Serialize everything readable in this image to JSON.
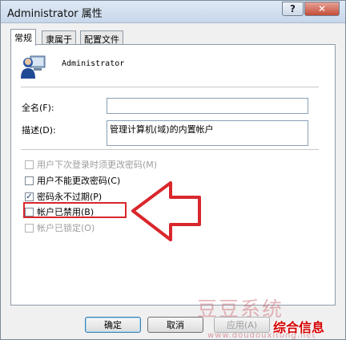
{
  "window": {
    "title": "Administrator 属性",
    "help_label": "?",
    "close_label": "✕"
  },
  "tabs": [
    {
      "label": "常规",
      "active": true
    },
    {
      "label": "隶属于",
      "active": false
    },
    {
      "label": "配置文件",
      "active": false
    }
  ],
  "general": {
    "username": "Administrator",
    "user_icon": "user-icon",
    "fullname_label": "全名(F):",
    "fullname_value": "",
    "description_label": "描述(D):",
    "description_value": "管理计算机(域)的内置帐户",
    "checkboxes": [
      {
        "label": "用户下次登录时须更改密码(M)",
        "checked": false,
        "enabled": false
      },
      {
        "label": "用户不能更改密码(C)",
        "checked": false,
        "enabled": true
      },
      {
        "label": "密码永不过期(P)",
        "checked": true,
        "enabled": true
      },
      {
        "label": "帐户已禁用(B)",
        "checked": false,
        "enabled": true
      },
      {
        "label": "帐户已锁定(O)",
        "checked": false,
        "enabled": false
      }
    ]
  },
  "annotation": {
    "highlight_color": "#d9272c"
  },
  "watermark": {
    "site_name": "豆豆系统",
    "site_url": "www.doudouxitong.net"
  },
  "buttons": {
    "ok": "确定",
    "cancel": "取消",
    "apply": "应用(A)"
  },
  "badge": {
    "text": "综合信息"
  }
}
